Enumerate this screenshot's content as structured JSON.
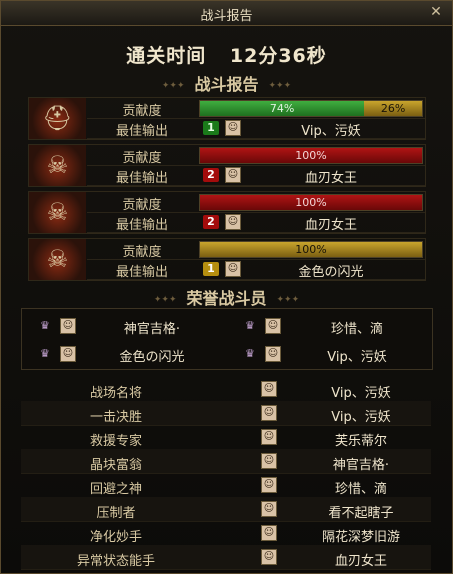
{
  "window": {
    "title": "战斗报告"
  },
  "clear_time": {
    "label": "通关时间",
    "value": "12分36秒"
  },
  "report_heading": "战斗报告",
  "row_labels": {
    "contribution": "贡献度",
    "best_output": "最佳输出"
  },
  "players": [
    {
      "icon": "fire-helmet-icon",
      "glyph": "⛑",
      "bar": [
        {
          "pct": 74,
          "label": "74%",
          "color": "green"
        },
        {
          "pct": 26,
          "label": "26%",
          "color": "gold"
        }
      ],
      "rank": "1",
      "rank_color": "g",
      "best": "Vip、污妖"
    },
    {
      "icon": "green-horned-helmet-icon",
      "glyph": "☠",
      "bar": [
        {
          "pct": 100,
          "label": "100%",
          "color": "red"
        }
      ],
      "rank": "2",
      "rank_color": "r",
      "best": "血刃女王"
    },
    {
      "icon": "golden-horned-helmet-icon",
      "glyph": "☠",
      "bar": [
        {
          "pct": 100,
          "label": "100%",
          "color": "red"
        }
      ],
      "rank": "2",
      "rank_color": "r",
      "best": "血刃女王"
    },
    {
      "icon": "blue-horned-helmet-icon",
      "glyph": "☠",
      "bar": [
        {
          "pct": 100,
          "label": "100%",
          "color": "gold"
        }
      ],
      "rank": "1",
      "rank_color": "y",
      "best": "金色の闪光"
    }
  ],
  "honor_heading": "荣誉战斗员",
  "honor_members": [
    "神官吉格·",
    "珍惜、滴",
    "金色の闪光",
    "Vip、污妖"
  ],
  "awards": [
    {
      "title": "战场名将",
      "player": "Vip、污妖"
    },
    {
      "title": "一击决胜",
      "player": "Vip、污妖"
    },
    {
      "title": "救援专家",
      "player": "芙乐蒂尔"
    },
    {
      "title": "晶块富翁",
      "player": "神官吉格·"
    },
    {
      "title": "回避之神",
      "player": "珍惜、滴"
    },
    {
      "title": "压制者",
      "player": "看不起瞎子"
    },
    {
      "title": "净化妙手",
      "player": "隔花深梦旧游"
    },
    {
      "title": "异常状态能手",
      "player": "血刃女王"
    }
  ],
  "colors": {
    "green": "#3fae3f",
    "gold": "#c9a52d",
    "red": "#b01414",
    "frame": "#5a4a2e"
  }
}
